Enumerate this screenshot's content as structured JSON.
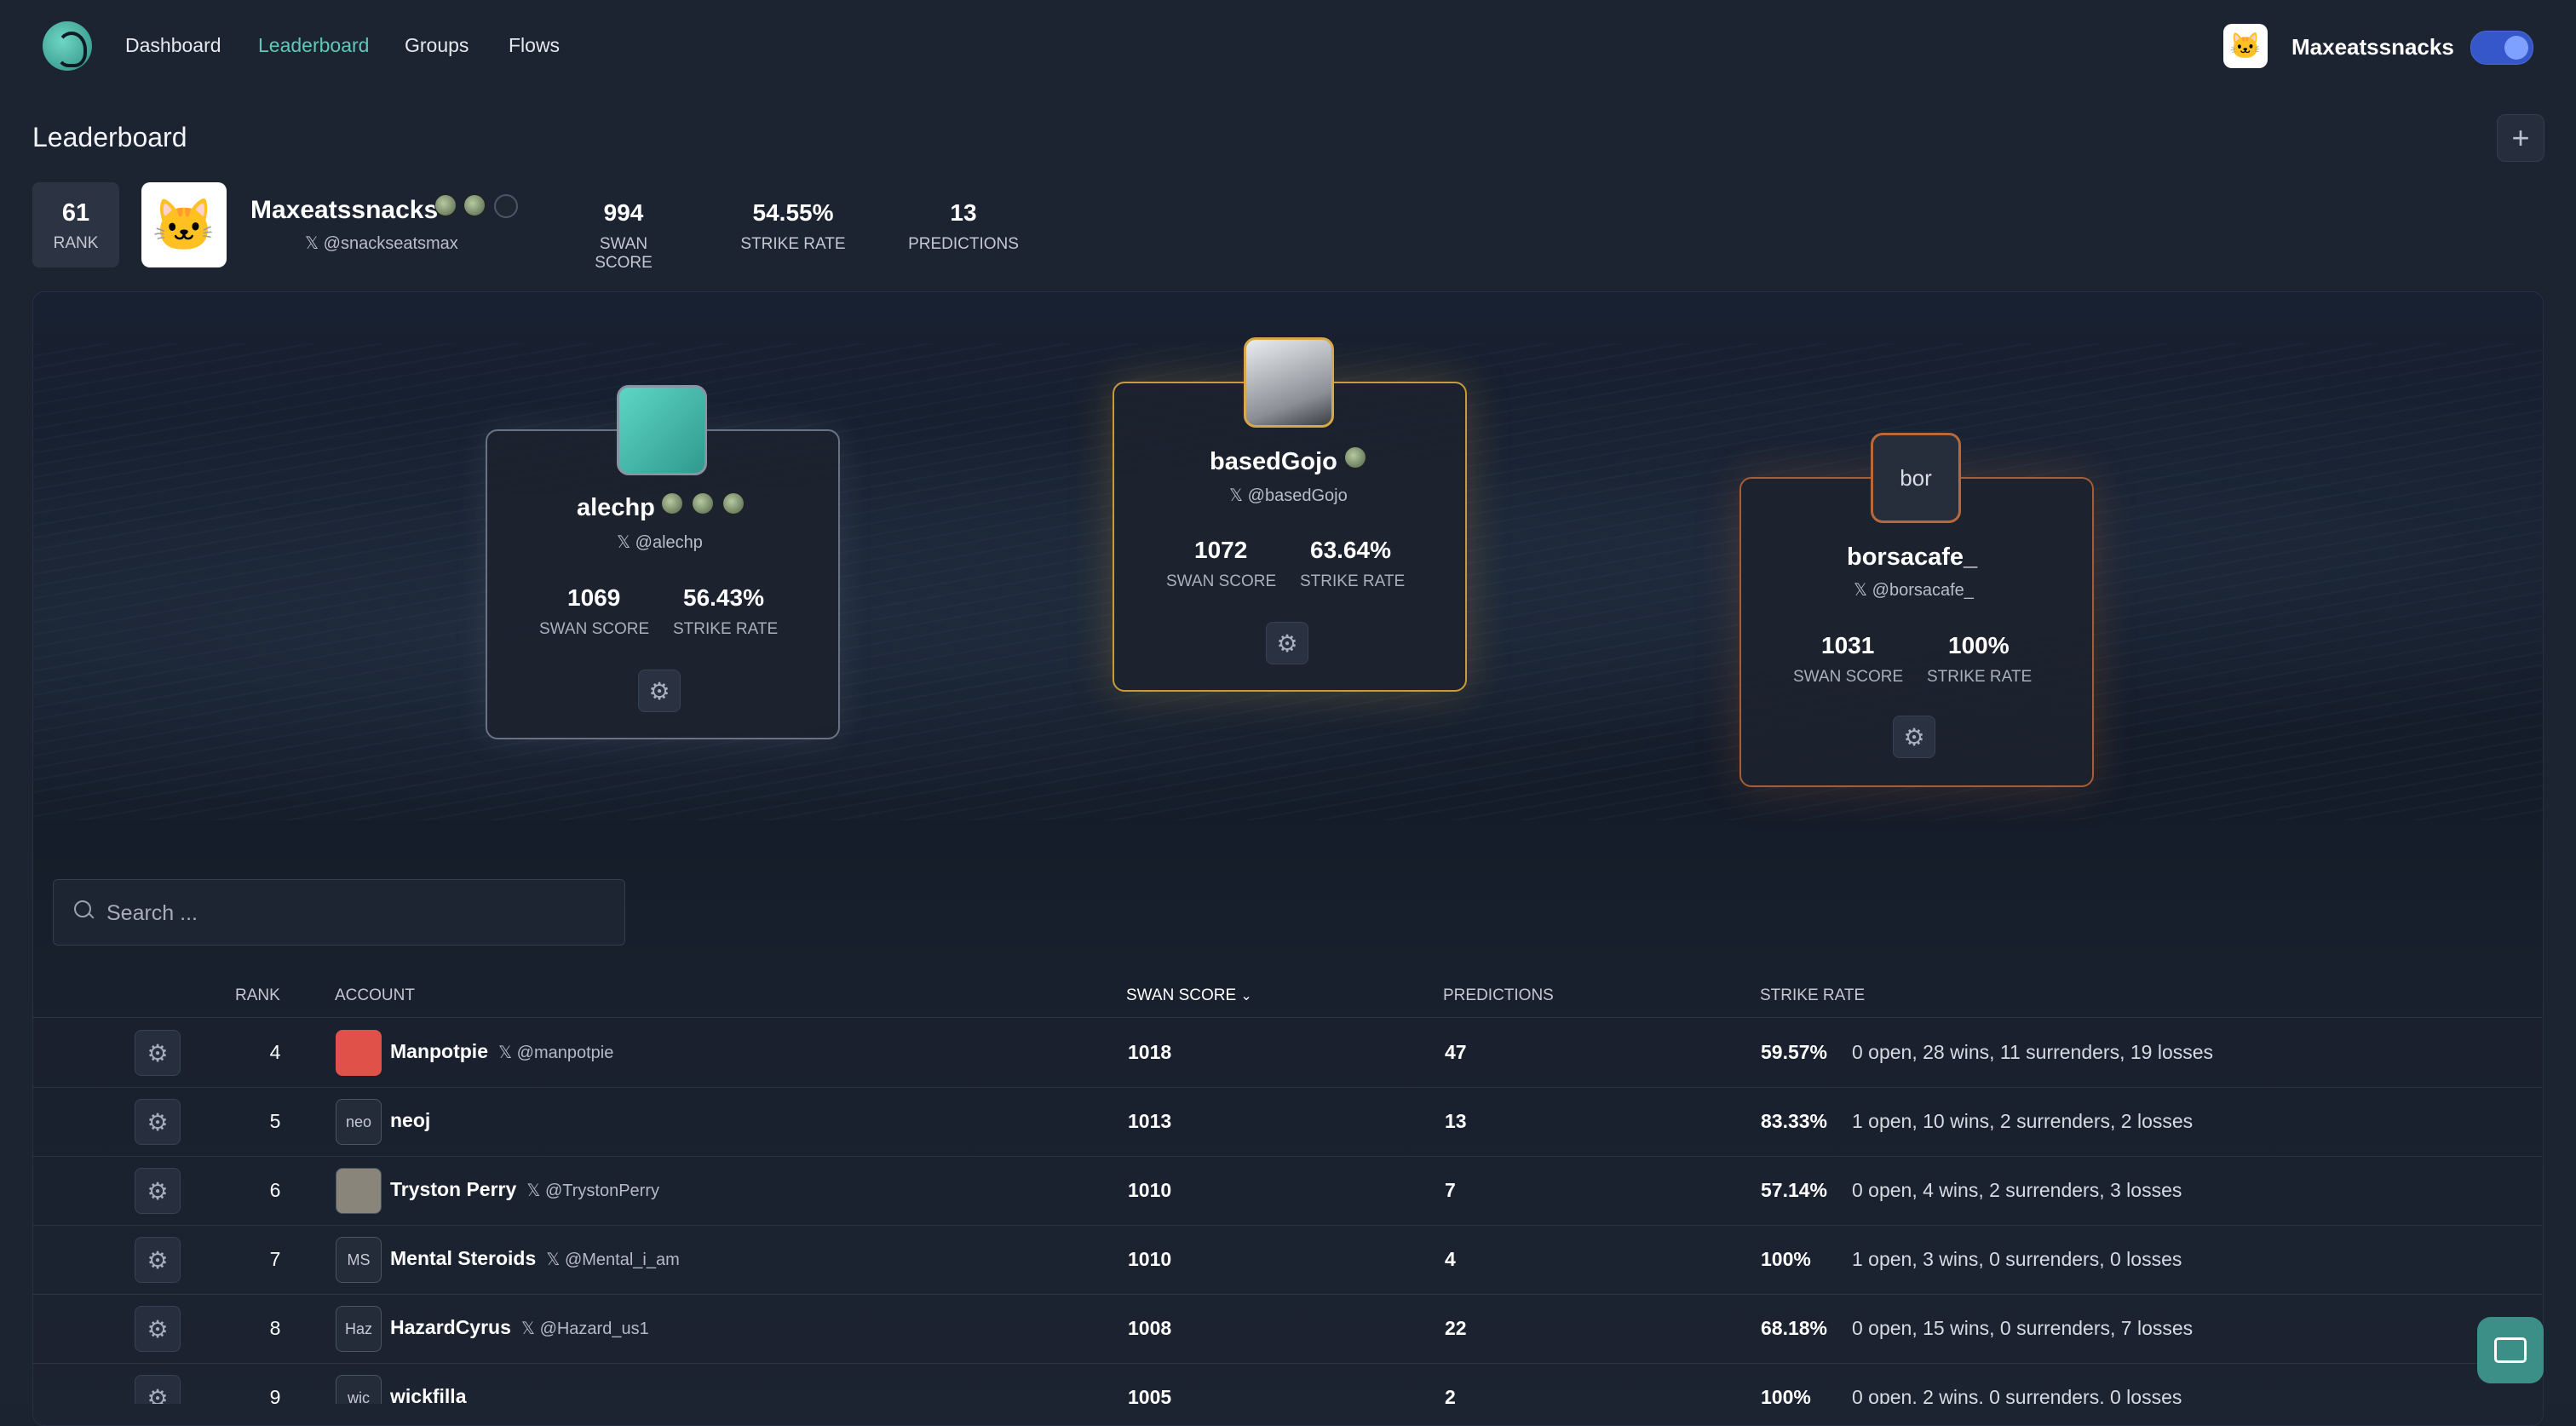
{
  "nav": {
    "links": [
      "Dashboard",
      "Leaderboard",
      "Groups",
      "Flows"
    ],
    "active": "Leaderboard",
    "user_name": "Maxeatssnacks",
    "accent": "#5fc9b7"
  },
  "page": {
    "title": "Leaderboard"
  },
  "me": {
    "rank": "61",
    "rank_label": "RANK",
    "name": "Maxeatssnacks",
    "handle": "@snackseatsmax",
    "stats": [
      {
        "value": "994",
        "label": "SWAN SCORE"
      },
      {
        "value": "54.55%",
        "label": "STRIKE RATE"
      },
      {
        "value": "13",
        "label": "PREDICTIONS"
      }
    ]
  },
  "podium": [
    {
      "place": "silver",
      "name": "alechp",
      "handle": "@alechp",
      "score": "1069",
      "score_label": "SWAN SCORE",
      "rate": "56.43%",
      "rate_label": "STRIKE RATE",
      "color": "#8a93a4"
    },
    {
      "place": "gold",
      "name": "basedGojo",
      "handle": "@basedGojo",
      "score": "1072",
      "score_label": "SWAN SCORE",
      "rate": "63.64%",
      "rate_label": "STRIKE RATE",
      "color": "#d6a846"
    },
    {
      "place": "bronze",
      "name": "borsacafe_",
      "handle": "@borsacafe_",
      "avatar_text": "bor",
      "score": "1031",
      "score_label": "SWAN SCORE",
      "rate": "100%",
      "rate_label": "STRIKE RATE",
      "color": "#b8693c"
    }
  ],
  "search": {
    "placeholder": "Search ..."
  },
  "table": {
    "headers": {
      "rank": "RANK",
      "account": "ACCOUNT",
      "score": "SWAN SCORE",
      "predictions": "PREDICTIONS",
      "rate": "STRIKE RATE"
    },
    "rows": [
      {
        "rank": "4",
        "avatar": "",
        "name": "Manpotpie",
        "handle": "@manpotpie",
        "score": "1018",
        "predictions": "47",
        "rate": "59.57%",
        "detail": "0 open, 28 wins, 11 surrenders, 19 losses"
      },
      {
        "rank": "5",
        "avatar": "neo",
        "name": "neoj",
        "handle": "",
        "score": "1013",
        "predictions": "13",
        "rate": "83.33%",
        "detail": "1 open, 10 wins, 2 surrenders, 2 losses"
      },
      {
        "rank": "6",
        "avatar": "",
        "name": "Tryston Perry",
        "handle": "@TrystonPerry",
        "score": "1010",
        "predictions": "7",
        "rate": "57.14%",
        "detail": "0 open, 4 wins, 2 surrenders, 3 losses"
      },
      {
        "rank": "7",
        "avatar": "MS",
        "name": "Mental Steroids",
        "handle": "@Mental_i_am",
        "score": "1010",
        "predictions": "4",
        "rate": "100%",
        "detail": "1 open, 3 wins, 0 surrenders, 0 losses"
      },
      {
        "rank": "8",
        "avatar": "Haz",
        "name": "HazardCyrus",
        "handle": "@Hazard_us1",
        "score": "1008",
        "predictions": "22",
        "rate": "68.18%",
        "detail": "0 open, 15 wins, 0 surrenders, 7 losses"
      },
      {
        "rank": "9",
        "avatar": "wic",
        "name": "wickfilla",
        "handle": "",
        "score": "1005",
        "predictions": "2",
        "rate": "100%",
        "detail": "0 open, 2 wins, 0 surrenders, 0 losses"
      }
    ]
  }
}
